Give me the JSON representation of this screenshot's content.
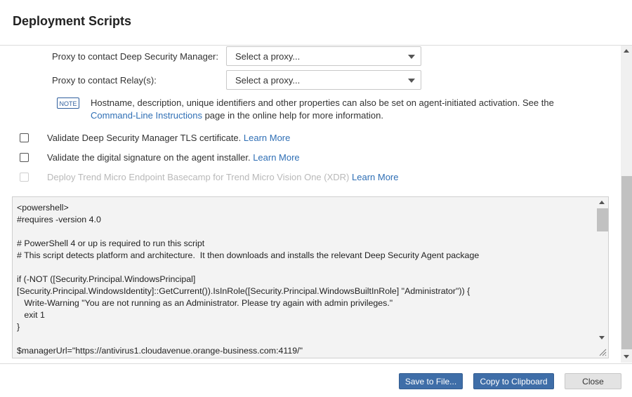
{
  "dialog": {
    "title": "Deployment Scripts"
  },
  "proxy": {
    "manager_label": "Proxy to contact Deep Security Manager:",
    "manager_value": "Select a proxy...",
    "relay_label": "Proxy to contact Relay(s):",
    "relay_value": "Select a proxy..."
  },
  "note": {
    "badge": "NOTE",
    "text_before": "Hostname, description, unique identifiers and other properties can also be set on agent-initiated activation. See the ",
    "link": "Command-Line Instructions",
    "text_after": " page in the online help for more information."
  },
  "options": [
    {
      "label": "Validate Deep Security Manager TLS certificate. ",
      "link": "Learn More",
      "checked": false,
      "disabled": false
    },
    {
      "label": "Validate the digital signature on the agent installer. ",
      "link": "Learn More",
      "checked": false,
      "disabled": false
    },
    {
      "label": "Deploy Trend Micro Endpoint Basecamp for Trend Micro Vision One (XDR) ",
      "link": "Learn More",
      "checked": false,
      "disabled": true
    }
  ],
  "script": {
    "text": "<powershell>\n#requires -version 4.0\n\n# PowerShell 4 or up is required to run this script\n# This script detects platform and architecture.  It then downloads and installs the relevant Deep Security Agent package\n\nif (-NOT ([Security.Principal.WindowsPrincipal]\n[Security.Principal.WindowsIdentity]::GetCurrent()).IsInRole([Security.Principal.WindowsBuiltInRole] \"Administrator\")) {\n   Write-Warning \"You are not running as an Administrator. Please try again with admin privileges.\"\n   exit 1\n}\n\n$managerUrl=\"https://antivirus1.cloudavenue.orange-business.com:4119/\""
  },
  "footer": {
    "save_label": "Save to File...",
    "copy_label": "Copy to Clipboard",
    "close_label": "Close"
  }
}
